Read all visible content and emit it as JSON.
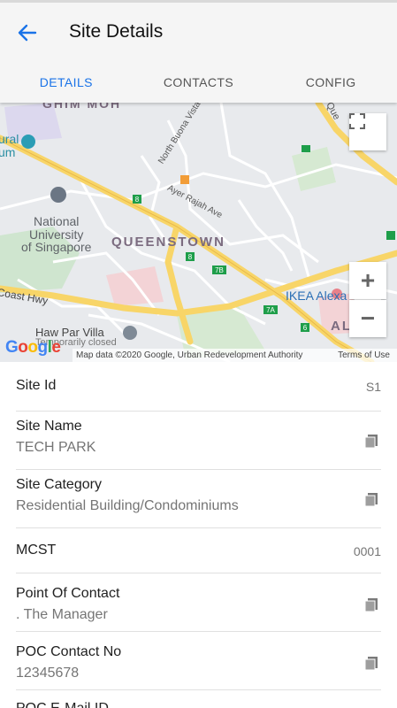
{
  "app": {
    "title": "Site Details"
  },
  "tabs": [
    {
      "label": "DETAILS",
      "active": true
    },
    {
      "label": "CONTACTS",
      "active": false
    },
    {
      "label": "CONFIG",
      "active": false
    }
  ],
  "map": {
    "labels": {
      "ghim_moh": "GHIM MOH",
      "museum_partial": "ural\num",
      "nbv_road": "North Buona Vista Rd",
      "ayer_rajah": "Ayer Rajah Ave",
      "nus": "National\nUniversity\nof Singapore",
      "queenstown": "QUEENSTOWN",
      "coast_hwy": "Coast Hwy",
      "ikea": "IKEA Alexa",
      "haw_par": "Haw Par Villa",
      "haw_par_closed": "Temporarily closed",
      "alex_partial": "AL",
      "que_partial": "Que",
      "badges": [
        "8",
        "8",
        "7B",
        "7A",
        "6"
      ]
    },
    "attribution": "Map data ©2020 Google, Urban Redevelopment Authority",
    "terms": "Terms of Use",
    "logo": "Google",
    "zoom_in": "+",
    "zoom_out": "−"
  },
  "fields": {
    "site_id": {
      "label": "Site Id",
      "value": "S1"
    },
    "site_name": {
      "label": "Site Name",
      "value": "TECH PARK"
    },
    "site_category": {
      "label": "Site Category",
      "value": "Residential Building/Condominiums"
    },
    "mcst": {
      "label": "MCST",
      "value": "0001"
    },
    "point_of_contact": {
      "label": "Point Of Contact",
      "value": ". The Manager"
    },
    "poc_contact_no": {
      "label": "POC Contact No",
      "value": "12345678"
    },
    "poc_email": {
      "label": "POC E-Mail ID"
    }
  },
  "colors": {
    "accent": "#1a73e8",
    "road_major": "#f8d568",
    "map_bg": "#e8eaed"
  },
  "icons": {
    "back": "arrow-left-icon",
    "copy": "clipboard-copy-icon",
    "fullscreen": "fullscreen-icon"
  }
}
